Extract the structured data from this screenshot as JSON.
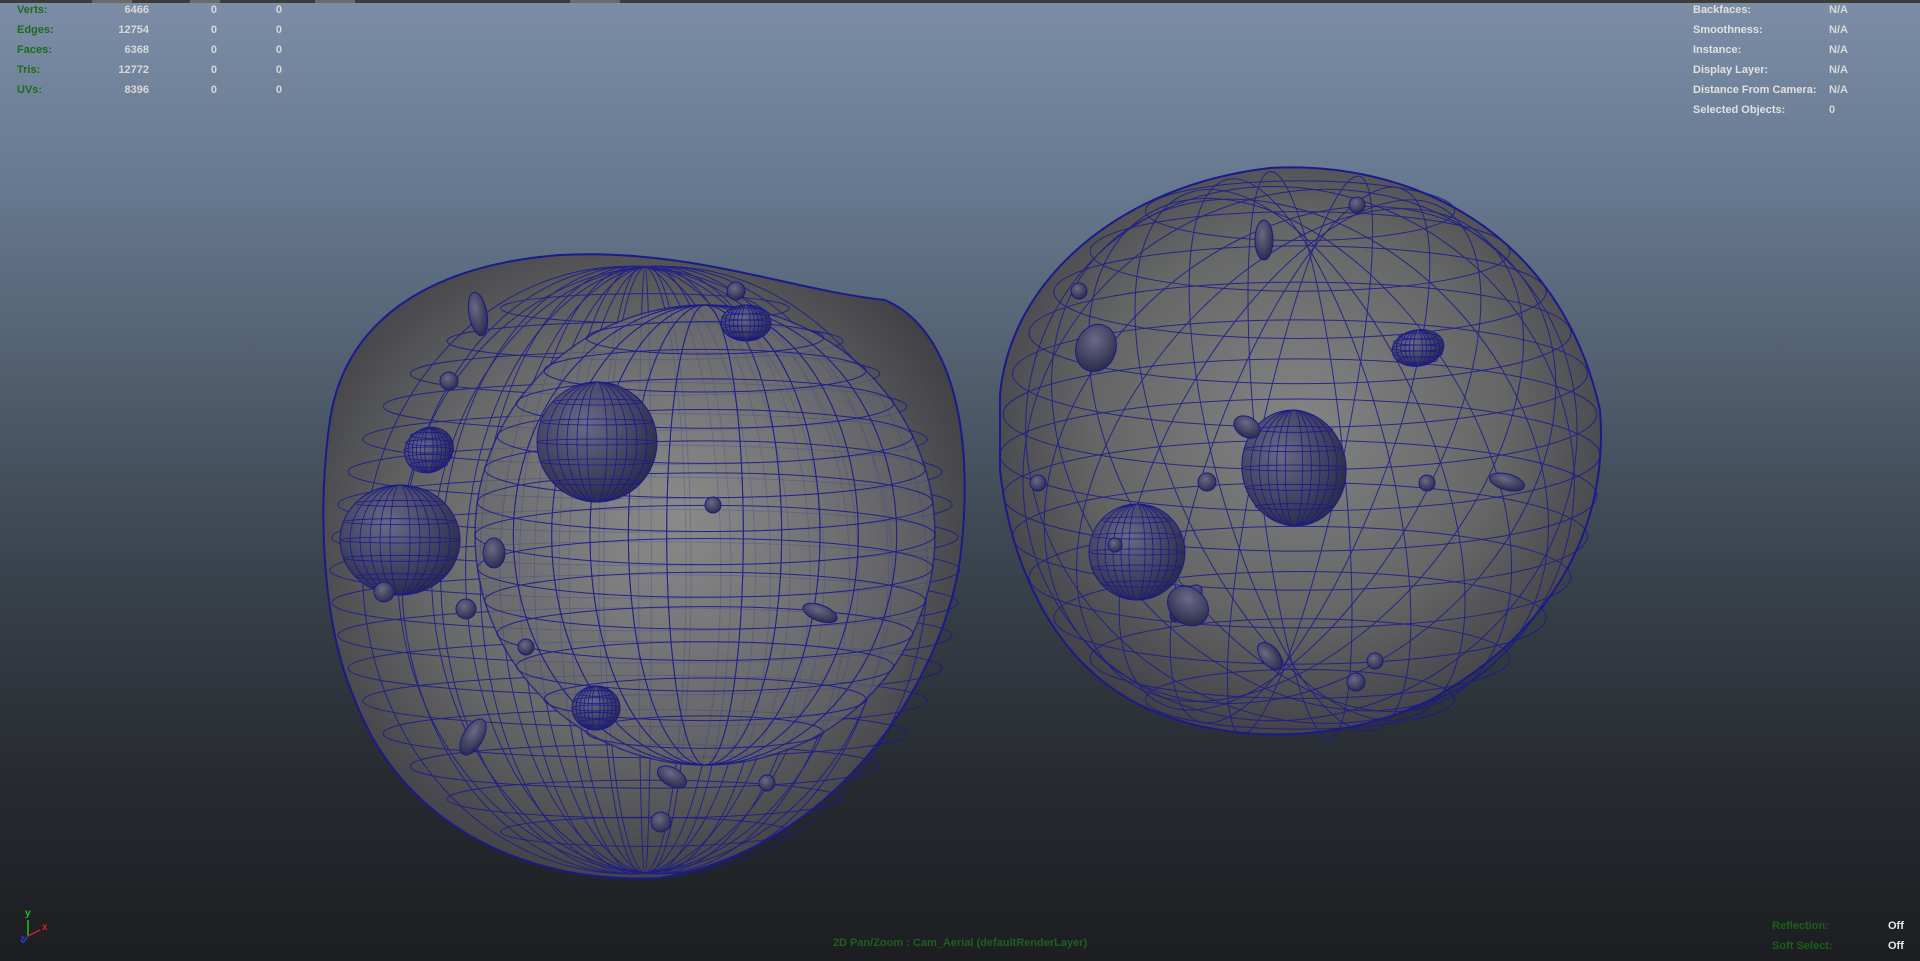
{
  "hud_stats": {
    "rows": [
      {
        "label": "Verts:",
        "v1": "6466",
        "v2": "0",
        "v3": "0"
      },
      {
        "label": "Edges:",
        "v1": "12754",
        "v2": "0",
        "v3": "0"
      },
      {
        "label": "Faces:",
        "v1": "6368",
        "v2": "0",
        "v3": "0"
      },
      {
        "label": "Tris:",
        "v1": "12772",
        "v2": "0",
        "v3": "0"
      },
      {
        "label": "UVs:",
        "v1": "8396",
        "v2": "0",
        "v3": "0"
      }
    ]
  },
  "hud_object_info": {
    "rows": [
      {
        "label": "Backfaces:",
        "value": "N/A"
      },
      {
        "label": "Smoothness:",
        "value": "N/A"
      },
      {
        "label": "Instance:",
        "value": "N/A"
      },
      {
        "label": "Display Layer:",
        "value": "N/A"
      },
      {
        "label": "Distance From Camera:",
        "value": "N/A"
      },
      {
        "label": "Selected Objects:",
        "value": "0"
      }
    ]
  },
  "hud_bottom_right": {
    "rows": [
      {
        "label": "Reflection:",
        "value": "Off"
      },
      {
        "label": "Soft Select:",
        "value": "Off"
      }
    ]
  },
  "camera_label": "2D Pan/Zoom : Cam_Aerial (defaultRenderLayer)",
  "axis_gizmo": {
    "y": "y",
    "x": "x",
    "z": "z"
  },
  "colors": {
    "wireframe": "#1a1a8c",
    "hud_label": "#1b6b1b",
    "hud_value": "#d8d8d8",
    "axis_x": "#d02020",
    "axis_y": "#20c020",
    "axis_z": "#2040d0"
  }
}
